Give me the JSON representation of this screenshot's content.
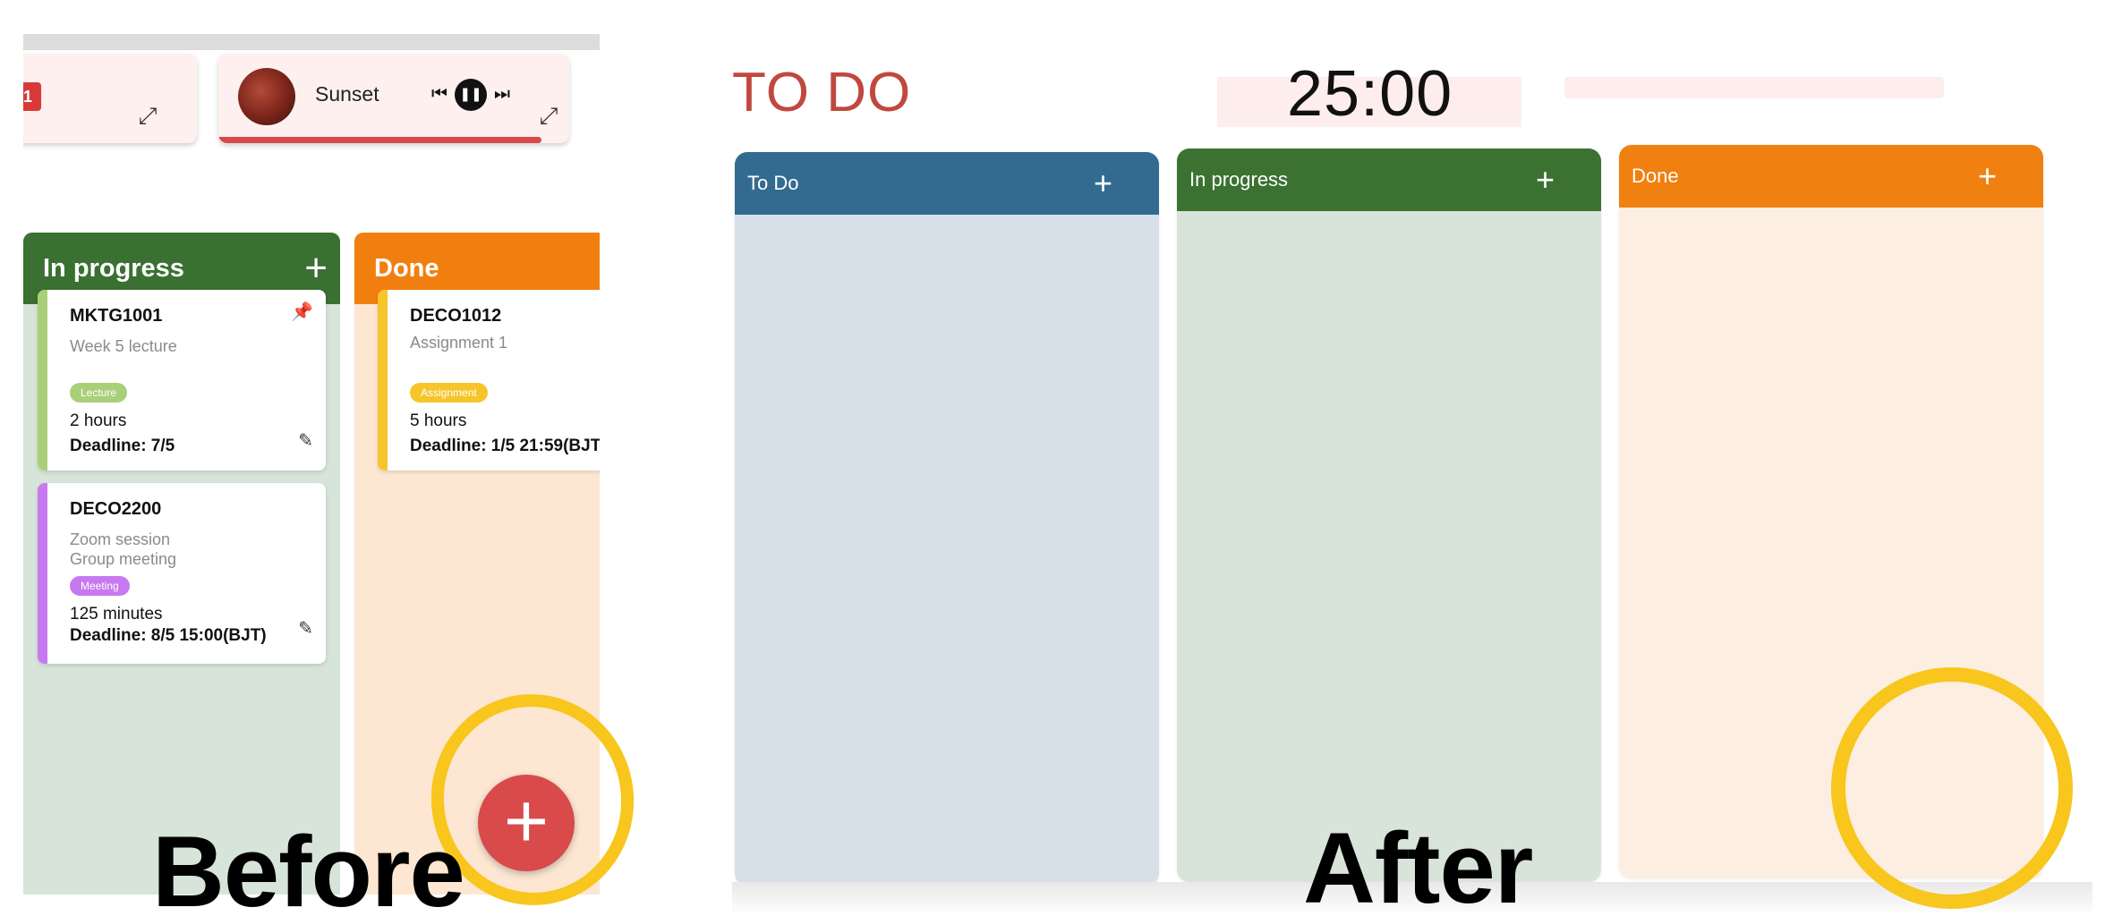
{
  "before": {
    "caption": "Before",
    "players": {
      "left": {
        "badge": "1",
        "expand_icon": "expand-icon"
      },
      "main": {
        "track": "Sunset",
        "prev_icon": "skip-previous-icon",
        "pause_icon": "pause-icon",
        "next_icon": "skip-next-icon",
        "expand_icon": "expand-icon",
        "progress": 0.92
      }
    },
    "columns": [
      {
        "title": "In progress",
        "add_label": "+",
        "color": "#3a7031"
      },
      {
        "title": "Done",
        "color": "#f17f0f"
      }
    ],
    "cards": [
      {
        "code": "MKTG1001",
        "desc": [
          "Week 5 lecture"
        ],
        "tag": "Lecture",
        "tag_color": "#a9cf78",
        "duration": "2 hours",
        "deadline": "Deadline: 7/5",
        "icons": [
          "pin-icon",
          "edit-icon"
        ]
      },
      {
        "code": "DECO2200",
        "desc": [
          "Zoom session",
          "Group meeting"
        ],
        "tag": "Meeting",
        "tag_color": "#c77af0",
        "duration": "125 minutes",
        "deadline": "Deadline: 8/5 15:00(BJT)",
        "icons": [
          "edit-icon"
        ]
      },
      {
        "code": "DECO1012",
        "desc": [
          "Assignment 1"
        ],
        "tag": "Assignment",
        "tag_color": "#f6c52a",
        "duration": "5 hours",
        "deadline": "Deadline: 1/5 21:59(BJT"
      }
    ],
    "fab_label": "+",
    "highlight_color": "#f8c61c"
  },
  "after": {
    "caption": "After",
    "page_title": "TO DO",
    "timer": "25:00",
    "columns": [
      {
        "title": "To Do",
        "add_label": "+",
        "color": "#326b8f"
      },
      {
        "title": "In progress",
        "add_label": "+",
        "color": "#3b7232"
      },
      {
        "title": "Done",
        "add_label": "+",
        "color": "#f08010"
      }
    ]
  }
}
